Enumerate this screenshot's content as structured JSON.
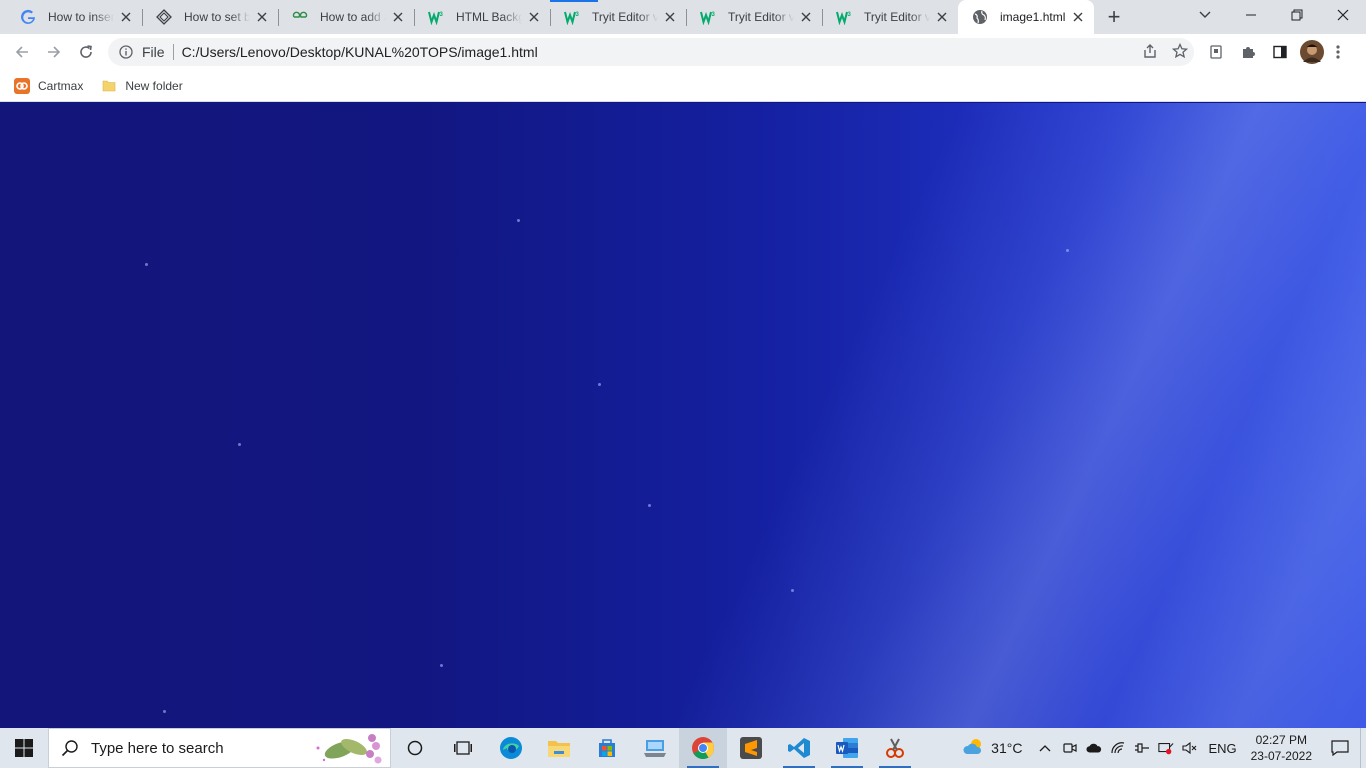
{
  "tabs": [
    {
      "title": "How to insert",
      "favicon": "google-icon",
      "active": false
    },
    {
      "title": "How to set ba",
      "favicon": "diamond-site-icon",
      "active": false
    },
    {
      "title": "How to add a",
      "favicon": "geeksforgeeks-icon",
      "active": false
    },
    {
      "title": "HTML Backgr",
      "favicon": "w3schools-icon",
      "active": false
    },
    {
      "title": "Tryit Editor v3",
      "favicon": "w3schools-icon",
      "active": false
    },
    {
      "title": "Tryit Editor v3",
      "favicon": "w3schools-icon",
      "active": false
    },
    {
      "title": "Tryit Editor v3",
      "favicon": "w3schools-icon",
      "active": false
    },
    {
      "title": "image1.html",
      "favicon": "globe-icon",
      "active": true
    }
  ],
  "toolbar": {
    "scheme": "File",
    "url": "C:/Users/Lenovo/Desktop/KUNAL%20TOPS/image1.html"
  },
  "bookmarks": [
    {
      "label": "Cartmax",
      "icon": "cartmax-icon"
    },
    {
      "label": "New folder",
      "icon": "folder-icon"
    }
  ],
  "taskbar": {
    "search_placeholder": "Type here to search",
    "weather_temp": "31°C",
    "language": "ENG",
    "time": "02:27 PM",
    "date": "23-07-2022"
  },
  "colors": {
    "page_bg_dark": "#14157a",
    "page_bg_light": "#3550e0",
    "w3_green": "#04aa6d",
    "accent_blue": "#1a73e8"
  }
}
